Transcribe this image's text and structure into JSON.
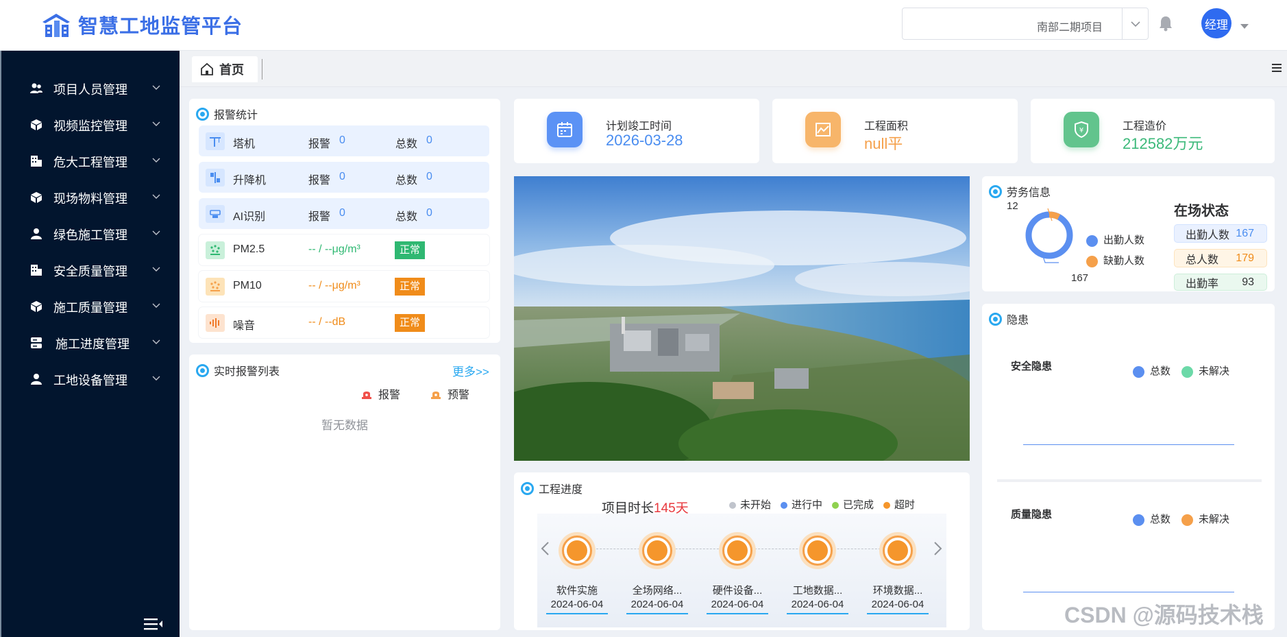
{
  "app": {
    "title": "智慧工地监管平台"
  },
  "header": {
    "project": "南部二期项目",
    "user": "经理"
  },
  "sidebar": {
    "items": [
      {
        "label": "项目人员管理",
        "icon": "users-icon"
      },
      {
        "label": "视频监控管理",
        "icon": "cube-icon"
      },
      {
        "label": "危大工程管理",
        "icon": "building-icon"
      },
      {
        "label": "现场物料管理",
        "icon": "cube-icon"
      },
      {
        "label": "绿色施工管理",
        "icon": "user-icon"
      },
      {
        "label": "安全质量管理",
        "icon": "building-icon"
      },
      {
        "label": "施工质量管理",
        "icon": "cube-icon"
      },
      {
        "label": "施工进度管理",
        "icon": "server-icon"
      },
      {
        "label": "工地设备管理",
        "icon": "user-icon"
      }
    ]
  },
  "tabs": {
    "home": "首页"
  },
  "alarm_stats": {
    "title": "报警统计",
    "alarm_label": "报警",
    "total_label": "总数",
    "devices": [
      {
        "name": "塔机",
        "alarm": "0",
        "total": "0"
      },
      {
        "name": "升降机",
        "alarm": "0",
        "total": "0"
      },
      {
        "name": "AI识别",
        "alarm": "0",
        "total": "0"
      }
    ],
    "env": [
      {
        "name": "PM2.5",
        "value": "-- / --μg/m³",
        "status": "正常",
        "color": "#2fb872"
      },
      {
        "name": "PM10",
        "value": "-- / --μg/m³",
        "status": "正常",
        "color": "#f08c1a"
      },
      {
        "name": "噪音",
        "value": "-- / --dB",
        "status": "正常",
        "color": "#f08c1a"
      }
    ]
  },
  "alarm_list": {
    "title": "实时报警列表",
    "more": "更多>>",
    "legend_alarm": "报警",
    "legend_warn": "预警",
    "empty": "暂无数据"
  },
  "stats": [
    {
      "label": "计划竣工时间",
      "value": "2026-03-28",
      "color": "#4a8df0"
    },
    {
      "label": "工程面积",
      "value": "null平",
      "color": "#f5a04a"
    },
    {
      "label": "工程造价",
      "value": "212582万元",
      "color": "#3cb97a"
    }
  ],
  "labor": {
    "title": "劳务信息",
    "donut_absent": "12",
    "donut_present": "167",
    "legend_present": "出勤人数",
    "legend_absent": "缺勤人数",
    "status_title": "在场状态",
    "present_label": "出勤人数",
    "present_value": "167",
    "total_label": "总人数",
    "total_value": "179",
    "rate_label": "出勤率",
    "rate_value": "93"
  },
  "hazard": {
    "title": "隐患",
    "safety_title": "安全隐患",
    "quality_title": "质量隐患",
    "legend_total": "总数",
    "legend_unresolved": "未解决"
  },
  "progress": {
    "title": "工程进度",
    "duration_label": "项目时长",
    "duration_value": "145天",
    "legend": [
      "未开始",
      "进行中",
      "已完成",
      "超时"
    ],
    "steps": [
      {
        "name": "软件实施",
        "date": "2024-06-04"
      },
      {
        "name": "全场网络...",
        "date": "2024-06-04"
      },
      {
        "name": "硬件设备...",
        "date": "2024-06-04"
      },
      {
        "name": "工地数据...",
        "date": "2024-06-04"
      },
      {
        "name": "环境数据...",
        "date": "2024-06-04"
      }
    ]
  },
  "watermark": "CSDN @源码技术栈"
}
